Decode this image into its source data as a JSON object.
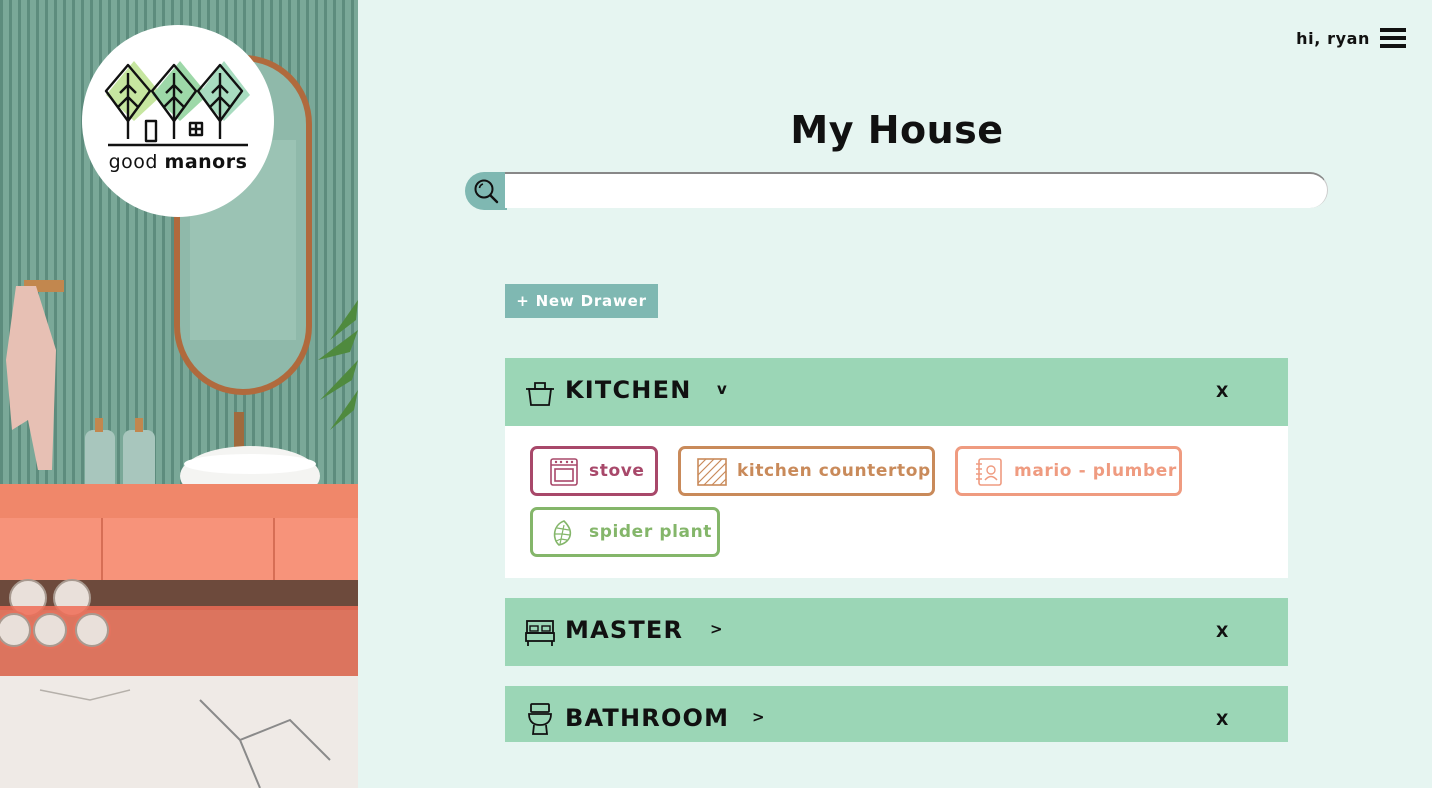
{
  "brand": {
    "name_light": "good ",
    "name_bold": "manors"
  },
  "header": {
    "greeting": "hi, ryan",
    "menu_icon": "hamburger-icon"
  },
  "page": {
    "title": "My House"
  },
  "search": {
    "placeholder": "",
    "value": "",
    "icon": "search-icon"
  },
  "actions": {
    "new_drawer_label": "+ New Drawer"
  },
  "colors": {
    "background": "#e6f5f1",
    "accent": "#7fb8b2",
    "drawer_header": "#9bd6b6",
    "stove": "#a8486a",
    "countertop": "#c98a5a",
    "contact": "#ef9b80",
    "plant": "#84b66a"
  },
  "drawers": [
    {
      "name": "KITCHEN",
      "icon": "pot-icon",
      "toggle": "v",
      "close": "X",
      "expanded": true,
      "items": [
        {
          "label": "stove",
          "icon": "stove-icon",
          "color": "#a8486a"
        },
        {
          "label": "kitchen countertop",
          "icon": "countertop-icon",
          "color": "#c98a5a"
        },
        {
          "label": "mario - plumber",
          "icon": "contact-book-icon",
          "color": "#ef9b80"
        },
        {
          "label": "spider plant",
          "icon": "leaf-icon",
          "color": "#84b66a"
        }
      ]
    },
    {
      "name": "MASTER",
      "icon": "bed-icon",
      "toggle": ">",
      "close": "X",
      "expanded": false
    },
    {
      "name": "BATHROOM",
      "icon": "toilet-icon",
      "toggle": ">",
      "close": "X",
      "expanded": false
    }
  ]
}
